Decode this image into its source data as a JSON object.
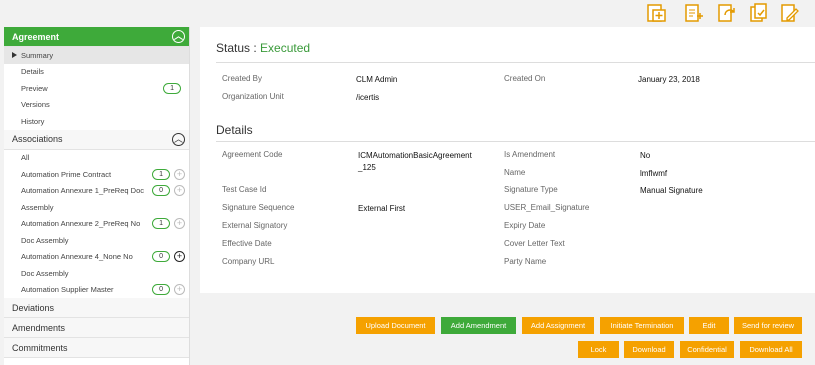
{
  "toolbar": {
    "icons": [
      "add-document-icon",
      "add-page-icon",
      "refresh-document-icon",
      "copy-document-icon",
      "edit-document-icon"
    ]
  },
  "sidebar": {
    "agreement": {
      "title": "Agreement",
      "items": [
        "Summary",
        "Details",
        "Preview",
        "Versions",
        "History"
      ],
      "preview_count": "1"
    },
    "associations": {
      "title": "Associations",
      "all": "All",
      "items": [
        {
          "label": "Automation Prime Contract",
          "count": "1"
        },
        {
          "label": "Automation Annexure 1_PreReq Doc",
          "count": "0"
        },
        {
          "label": "Assembly"
        },
        {
          "label": "Automation Annexure 2_PreReq No",
          "count": "1"
        },
        {
          "label": "Doc Assembly"
        },
        {
          "label": "Automation Annexure 4_None No",
          "count": "0"
        },
        {
          "label": "Doc Assembly"
        },
        {
          "label": "Automation Supplier Master",
          "count": "0"
        }
      ]
    },
    "deviations": "Deviations",
    "amendments": "Amendments",
    "commitments": "Commitments"
  },
  "status": {
    "label": "Status :",
    "value": "Executed"
  },
  "info": {
    "created_by_label": "Created By",
    "created_by": "CLM Admin",
    "created_on_label": "Created On",
    "created_on": "January 23, 2018",
    "org_label": "Organization Unit",
    "org": "/icertis"
  },
  "details": {
    "title": "Details",
    "agreement_code_label": "Agreement Code",
    "agreement_code_1": "ICMAutomationBasicAgreement",
    "agreement_code_2": "_125",
    "is_amendment_label": "Is Amendment",
    "is_amendment": "No",
    "name_label": "Name",
    "name": "lmflwmf",
    "test_case_label": "Test Case Id",
    "signature_type_label": "Signature Type",
    "signature_type": "Manual Signature",
    "signature_seq_label": "Signature Sequence",
    "signature_seq": "External First",
    "user_email_label": "USER_Email_Signature",
    "external_sig_label": "External Signatory",
    "expiry_label": "Expiry Date",
    "effective_label": "Effective Date",
    "cover_label": "Cover Letter Text",
    "company_url_label": "Company URL",
    "party_label": "Party Name"
  },
  "actions": {
    "upload": "Upload Document",
    "add_amendment": "Add Amendment",
    "add_assignment": "Add Assignment",
    "initiate_termination": "Initiate Termination",
    "edit": "Edit",
    "send_review": "Send for review",
    "lock": "Lock",
    "download": "Download",
    "confidential": "Confidential",
    "download_all": "Download All"
  },
  "colors": {
    "accent_green": "#3eaa3a",
    "button_orange": "#f5a100"
  }
}
